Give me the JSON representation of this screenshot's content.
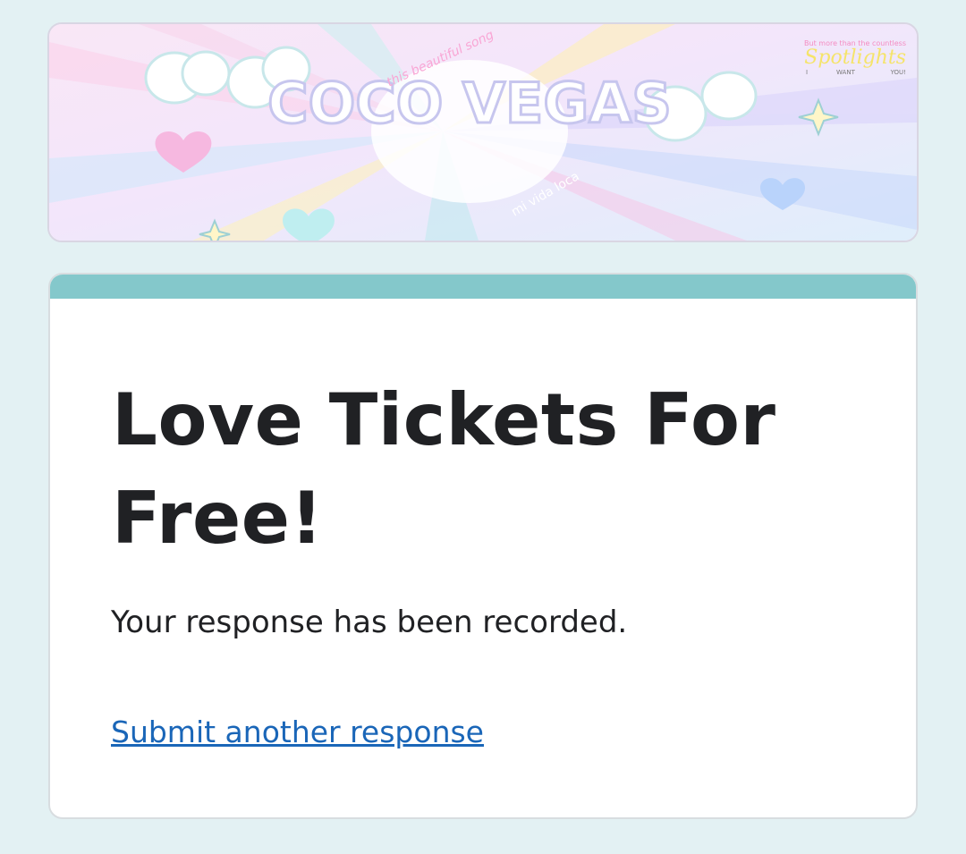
{
  "banner": {
    "logo_text": "COCO VEGAS",
    "tagline_left": "this beautiful song",
    "tagline_center": "mi vida loca",
    "corner_top": "But more than the countless",
    "corner_main": "Spotlights",
    "corner_bottom_i": "I",
    "corner_bottom_want": "WANT",
    "corner_bottom_you": "YOU!"
  },
  "form": {
    "title": "Love Tickets For Free!",
    "confirmation": "Your response has been recorded.",
    "submit_another": "Submit another response"
  },
  "colors": {
    "page_background": "#e3f1f3",
    "accent_bar": "#84c8cb",
    "title_text": "#202124",
    "link": "#1a66b8"
  }
}
